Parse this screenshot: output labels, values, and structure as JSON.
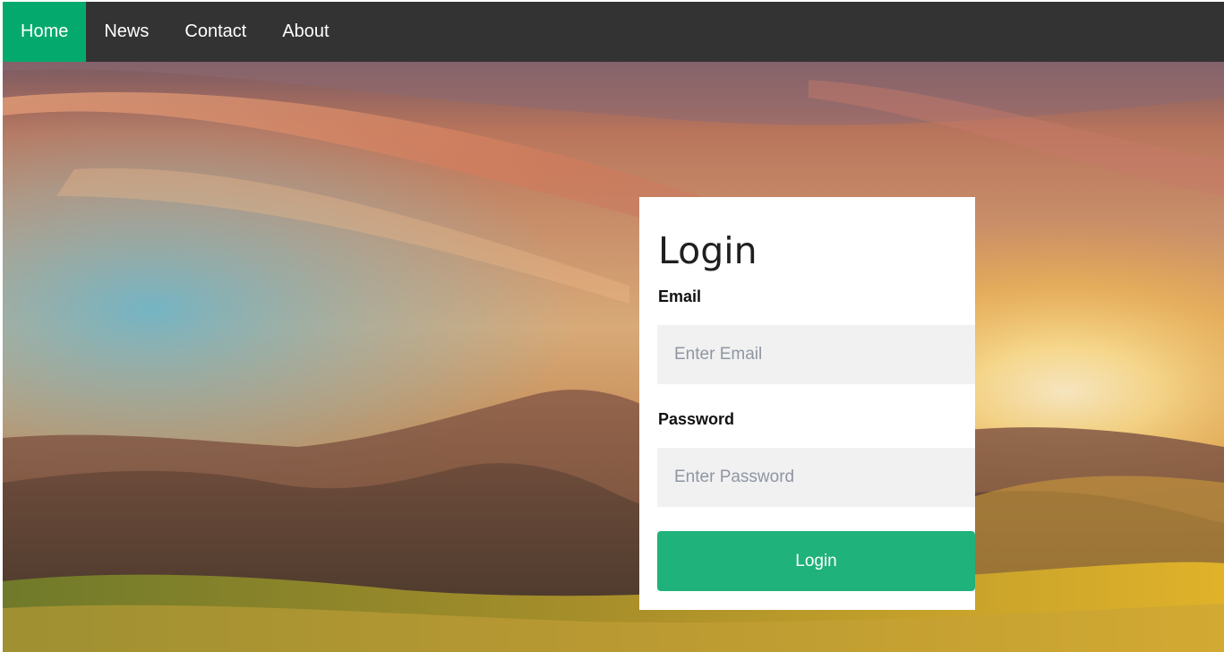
{
  "nav": {
    "items": [
      {
        "label": "Home",
        "active": true
      },
      {
        "label": "News",
        "active": false
      },
      {
        "label": "Contact",
        "active": false
      },
      {
        "label": "About",
        "active": false
      }
    ]
  },
  "login": {
    "title": "Login",
    "email_label": "Email",
    "email_placeholder": "Enter Email",
    "password_label": "Password",
    "password_placeholder": "Enter Password",
    "button_label": "Login"
  },
  "colors": {
    "nav_bg": "#333333",
    "nav_active": "#04AA6D",
    "button": "#1fb27a",
    "input_bg": "#f1f1f1"
  }
}
